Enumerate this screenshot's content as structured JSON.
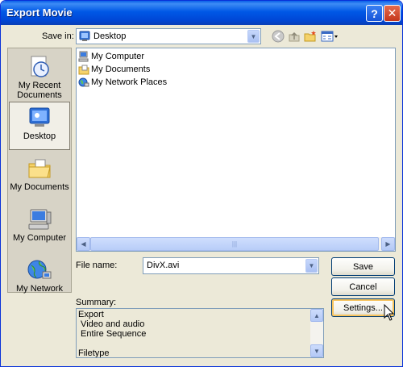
{
  "window": {
    "title": "Export Movie",
    "help_glyph": "?",
    "close_glyph": "✕"
  },
  "save_in": {
    "label": "Save in:",
    "value": "Desktop"
  },
  "toolbar": {
    "back_icon": "back-arrow-icon",
    "up_icon": "up-folder-icon",
    "new_folder_icon": "new-folder-icon",
    "views_icon": "views-menu-icon"
  },
  "places": [
    {
      "label": "My Recent Documents",
      "icon": "recent-documents-icon"
    },
    {
      "label": "Desktop",
      "icon": "desktop-icon",
      "selected": true
    },
    {
      "label": "My Documents",
      "icon": "my-documents-icon"
    },
    {
      "label": "My Computer",
      "icon": "my-computer-icon"
    },
    {
      "label": "My Network",
      "icon": "my-network-icon"
    }
  ],
  "files": [
    {
      "name": "My Computer",
      "icon": "my-computer-icon"
    },
    {
      "name": "My Documents",
      "icon": "my-documents-icon"
    },
    {
      "name": "My Network Places",
      "icon": "network-places-icon"
    }
  ],
  "file_name": {
    "label": "File name:",
    "value": "DivX.avi"
  },
  "buttons": {
    "save": "Save",
    "cancel": "Cancel",
    "settings": "Settings..."
  },
  "summary": {
    "label": "Summary:",
    "lines": [
      "Export",
      " Video and audio",
      " Entire Sequence",
      "",
      "Filetype"
    ]
  },
  "colors": {
    "title_bar": "#0058e6",
    "dialog_bg": "#ece9d8",
    "button_border": "#003c74",
    "focus_highlight": "#f7c35d"
  }
}
